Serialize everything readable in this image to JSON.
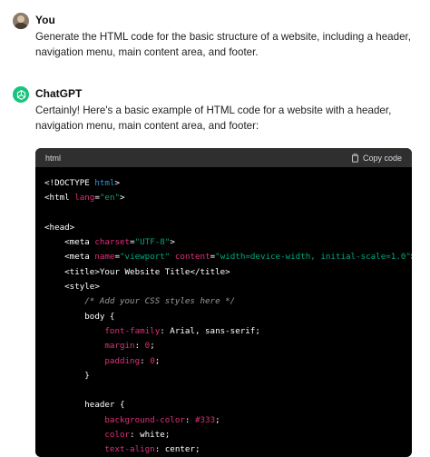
{
  "user_message": {
    "author": "You",
    "text": "Generate the HTML code for the basic structure of a website, including a header, navigation menu, main content area, and footer."
  },
  "assistant_message": {
    "author": "ChatGPT",
    "text": "Certainly! Here's a basic example of HTML code for a website with a header, navigation menu, main content area, and footer:"
  },
  "code_block": {
    "language": "html",
    "copy_label": "Copy code",
    "lines": [
      [
        [
          "<!DOCTYPE ",
          "c-plain"
        ],
        [
          "html",
          "c-kw"
        ],
        [
          ">",
          "c-plain"
        ]
      ],
      [
        [
          "<html ",
          "c-tag"
        ],
        [
          "lang",
          "c-attr"
        ],
        [
          "=",
          "c-plain"
        ],
        [
          "\"en\"",
          "c-str"
        ],
        [
          ">",
          "c-tag"
        ]
      ],
      [
        [
          "",
          ""
        ]
      ],
      [
        [
          "<head>",
          "c-tag"
        ]
      ],
      [
        [
          "    <meta ",
          "c-tag"
        ],
        [
          "charset",
          "c-attr"
        ],
        [
          "=",
          "c-plain"
        ],
        [
          "\"UTF-8\"",
          "c-str"
        ],
        [
          ">",
          "c-tag"
        ]
      ],
      [
        [
          "    <meta ",
          "c-tag"
        ],
        [
          "name",
          "c-attr"
        ],
        [
          "=",
          "c-plain"
        ],
        [
          "\"viewport\"",
          "c-str"
        ],
        [
          " ",
          ""
        ],
        [
          "content",
          "c-attr"
        ],
        [
          "=",
          "c-plain"
        ],
        [
          "\"width=device-width, initial-scale=1.0\"",
          "c-str"
        ],
        [
          ">",
          "c-tag"
        ]
      ],
      [
        [
          "    <title>",
          "c-tag"
        ],
        [
          "Your Website Title",
          "c-plain"
        ],
        [
          "</title>",
          "c-tag"
        ]
      ],
      [
        [
          "    <style>",
          "c-tag"
        ]
      ],
      [
        [
          "        /* Add your CSS styles here */",
          "c-cm"
        ]
      ],
      [
        [
          "        body {",
          "c-plain"
        ]
      ],
      [
        [
          "            font-family",
          "c-prop"
        ],
        [
          ": Arial, sans-serif;",
          "c-plain"
        ]
      ],
      [
        [
          "            margin",
          "c-prop"
        ],
        [
          ": ",
          "c-plain"
        ],
        [
          "0",
          "c-num"
        ],
        [
          ";",
          "c-plain"
        ]
      ],
      [
        [
          "            padding",
          "c-prop"
        ],
        [
          ": ",
          "c-plain"
        ],
        [
          "0",
          "c-num"
        ],
        [
          ";",
          "c-plain"
        ]
      ],
      [
        [
          "        }",
          "c-plain"
        ]
      ],
      [
        [
          "",
          ""
        ]
      ],
      [
        [
          "        header {",
          "c-plain"
        ]
      ],
      [
        [
          "            background-color",
          "c-prop"
        ],
        [
          ": ",
          "c-plain"
        ],
        [
          "#333",
          "c-hex"
        ],
        [
          ";",
          "c-plain"
        ]
      ],
      [
        [
          "            color",
          "c-prop"
        ],
        [
          ": white;",
          "c-plain"
        ]
      ],
      [
        [
          "            text-align",
          "c-prop"
        ],
        [
          ": center;",
          "c-plain"
        ]
      ]
    ]
  },
  "colors": {
    "assistant_avatar": "#19c37d",
    "code_background": "#000000",
    "code_header": "#2f2f2f"
  },
  "icons": [
    "user-avatar",
    "openai-logo-icon",
    "clipboard-icon"
  ]
}
